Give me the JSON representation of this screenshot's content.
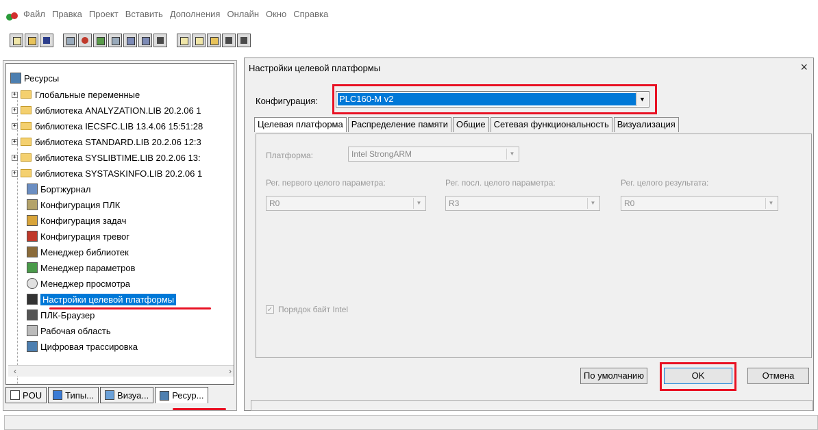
{
  "menu": {
    "items": [
      "Файл",
      "Правка",
      "Проект",
      "Вставить",
      "Дополнения",
      "Онлайн",
      "Окно",
      "Справка"
    ]
  },
  "tree": {
    "root_label": "Ресурсы",
    "items": [
      {
        "label": "Глобальные переменные",
        "icon": "folder-icon"
      },
      {
        "label": "библиотека ANALYZATION.LIB 20.2.06 1",
        "icon": "folder-icon"
      },
      {
        "label": "библиотека IECSFC.LIB 13.4.06 15:51:28",
        "icon": "folder-icon"
      },
      {
        "label": "библиотека STANDARD.LIB 20.2.06 12:3",
        "icon": "folder-icon"
      },
      {
        "label": "библиотека SYSLIBTIME.LIB 20.2.06 13:",
        "icon": "folder-icon"
      },
      {
        "label": "библиотека SYSTASKINFO.LIB 20.2.06 1",
        "icon": "folder-icon"
      },
      {
        "label": "Бортжурнал",
        "icon": "logbook-icon"
      },
      {
        "label": "Конфигурация ПЛК",
        "icon": "plc-config-icon"
      },
      {
        "label": "Конфигурация задач",
        "icon": "task-config-icon"
      },
      {
        "label": "Конфигурация тревог",
        "icon": "alarm-config-icon"
      },
      {
        "label": "Менеджер библиотек",
        "icon": "library-manager-icon"
      },
      {
        "label": "Менеджер параметров",
        "icon": "parameter-manager-icon"
      },
      {
        "label": "Менеджер просмотра",
        "icon": "magnifier-icon"
      },
      {
        "label": "Настройки целевой платформы",
        "icon": "target-settings-icon",
        "selected": true
      },
      {
        "label": "ПЛК-Браузер",
        "icon": "plc-browser-icon"
      },
      {
        "label": "Рабочая область",
        "icon": "workspace-icon"
      },
      {
        "label": "Цифровая трассировка",
        "icon": "trace-icon"
      }
    ]
  },
  "bottom_tabs": [
    "POU",
    "Типы...",
    "Визуа...",
    "Ресур..."
  ],
  "dialog": {
    "title": "Настройки целевой платформы",
    "close_glyph": "×",
    "config_label": "Конфигурация:",
    "config_value": "PLC160-M v2",
    "tabs": [
      "Целевая платформа",
      "Распределение памяти",
      "Общие",
      "Сетевая функциональность",
      "Визуализация"
    ],
    "platform_label": "Платформа:",
    "platform_value": "Intel StrongARM",
    "first_param_label": "Рег. первого целого параметра:",
    "first_param_value": "R0",
    "last_param_label": "Рег. посл. целого параметра:",
    "last_param_value": "R3",
    "result_label": "Рег. целого результата:",
    "result_value": "R0",
    "byte_order_label": "Порядок байт Intel",
    "byte_order_checked": true,
    "default_button": "По умолчанию",
    "ok_button": "OK",
    "cancel_button": "Отмена"
  },
  "colors": {
    "selection": "#0078d7",
    "highlight_red": "#e81123"
  }
}
